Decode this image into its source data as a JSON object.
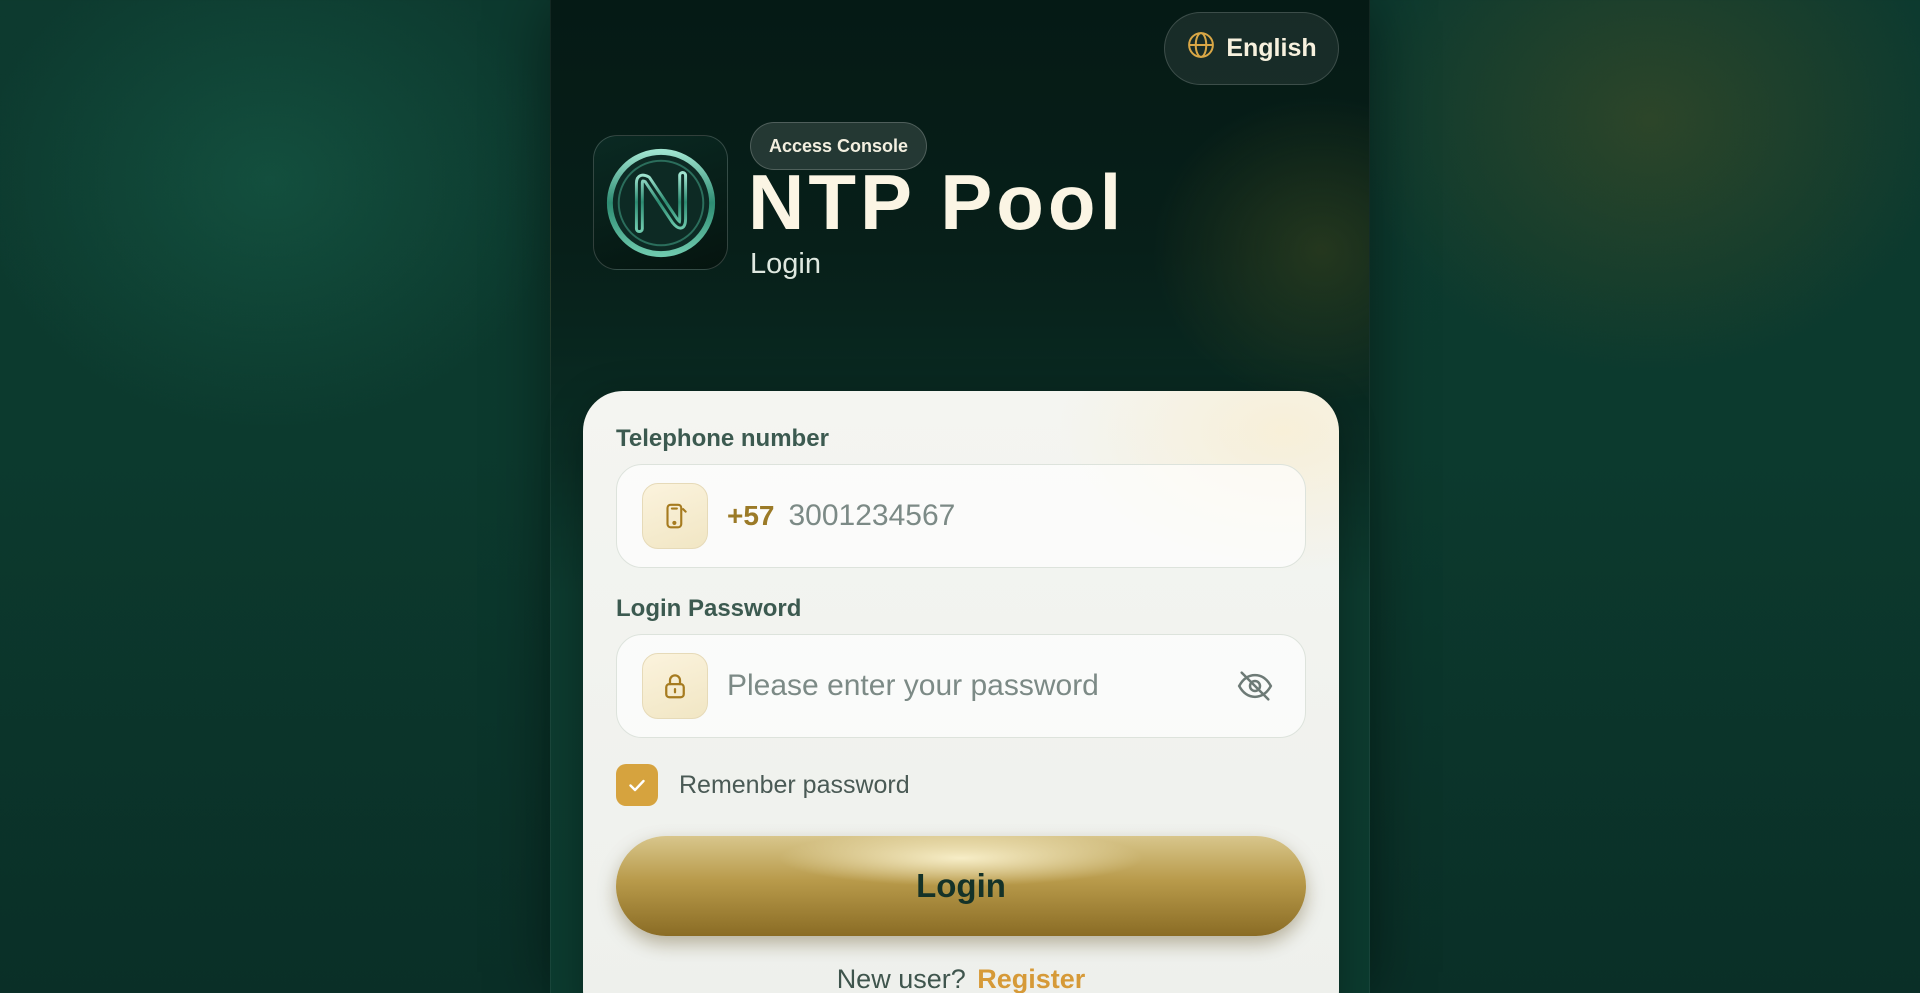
{
  "header": {
    "language_label": "English",
    "chip_label": "Access Console",
    "app_title": "NTP Pool",
    "page_subtitle": "Login"
  },
  "form": {
    "phone_label": "Telephone number",
    "country_code": "+57",
    "phone_placeholder": "3001234567",
    "password_label": "Login Password",
    "password_placeholder": "Please enter your password",
    "remember_label": "Remenber password",
    "remember_checked": true,
    "login_button": "Login",
    "new_user_text": "New user?",
    "register_link": "Register"
  },
  "icons": {
    "language": "globe-icon",
    "logo": "n-logo",
    "phone": "phone-icon",
    "password": "lock-icon",
    "visibility": "eye-off-icon",
    "checkbox": "check-icon"
  },
  "colors": {
    "accent_gold": "#d6a33e",
    "title_cream": "#fbf5e4",
    "background_green": "#0c3a2e"
  }
}
